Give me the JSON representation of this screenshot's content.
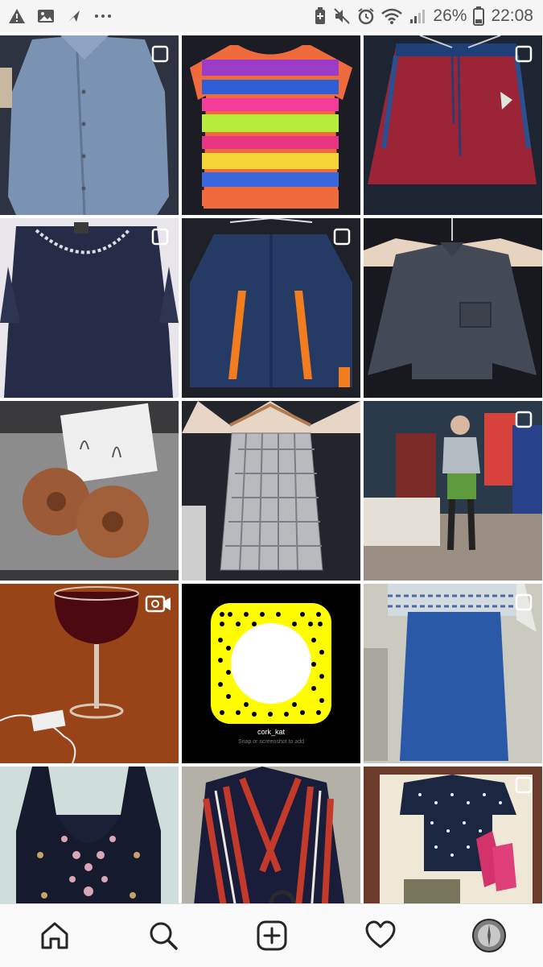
{
  "status_bar": {
    "battery_percent": "26%",
    "time": "22:08"
  },
  "grid": {
    "snapcode_username": "cork_kat",
    "snapcode_caption": "Snap or screenshot to add"
  },
  "nav": {
    "items": [
      "home-icon",
      "search-icon",
      "add-post-icon",
      "heart-icon",
      "profile-avatar"
    ]
  },
  "colors": {
    "status_bg": "#f5f5f5",
    "nav_bg": "#fafafa",
    "snap_yellow": "#fffc00"
  }
}
